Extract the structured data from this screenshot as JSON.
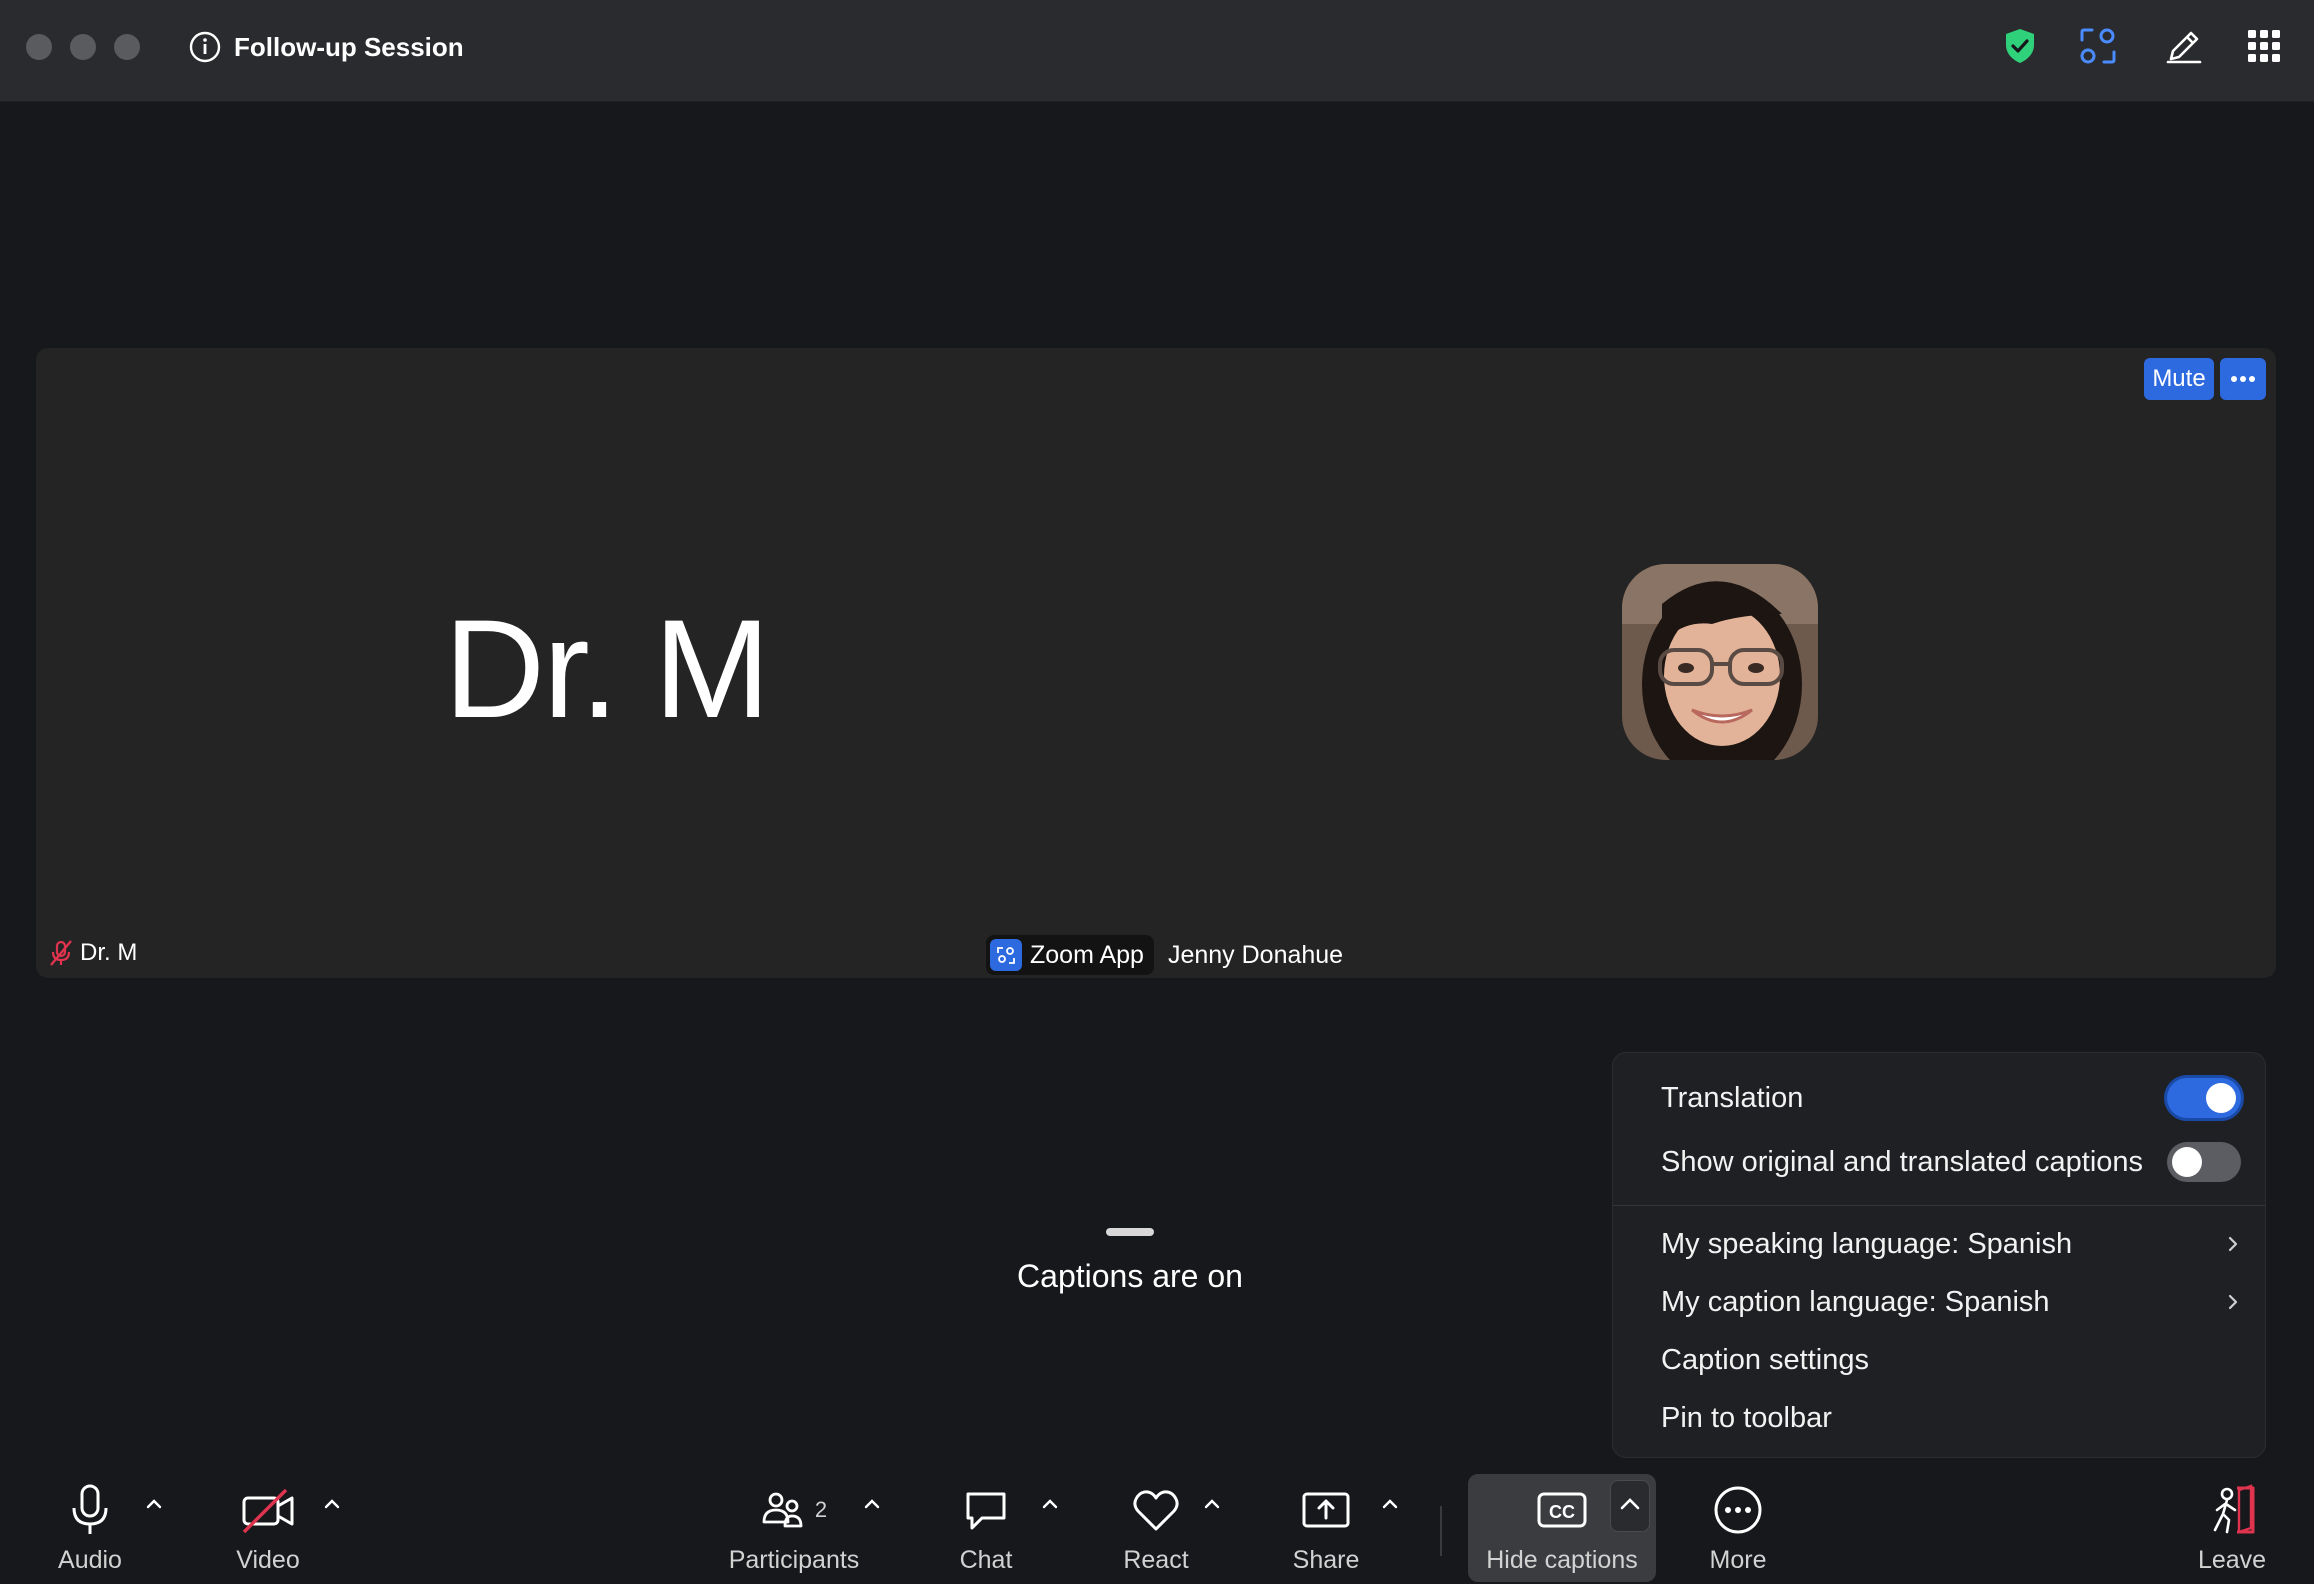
{
  "window": {
    "title": "Follow-up Session"
  },
  "stage": {
    "main_name": "Dr. M",
    "name_tag": "Dr. M",
    "app_label": "Zoom App",
    "participant_name": "Jenny Donahue",
    "mute_label": "Mute"
  },
  "captions": {
    "status": "Captions are on"
  },
  "caption_menu": {
    "translation_label": "Translation",
    "translation_on": true,
    "show_original_label": "Show original and translated captions",
    "show_original_on": false,
    "speaking_language": "My speaking language: Spanish",
    "caption_language": "My caption language: Spanish",
    "caption_settings": "Caption settings",
    "pin_to_toolbar": "Pin to toolbar"
  },
  "toolbar": {
    "audio": "Audio",
    "video": "Video",
    "participants": "Participants",
    "participants_count": "2",
    "chat": "Chat",
    "react": "React",
    "share": "Share",
    "hide_captions": "Hide captions",
    "more": "More",
    "leave": "Leave"
  },
  "colors": {
    "accent": "#2d6ae0",
    "shield": "#2fd17b",
    "leave": "#e0344e",
    "video_off": "#e0344e"
  }
}
